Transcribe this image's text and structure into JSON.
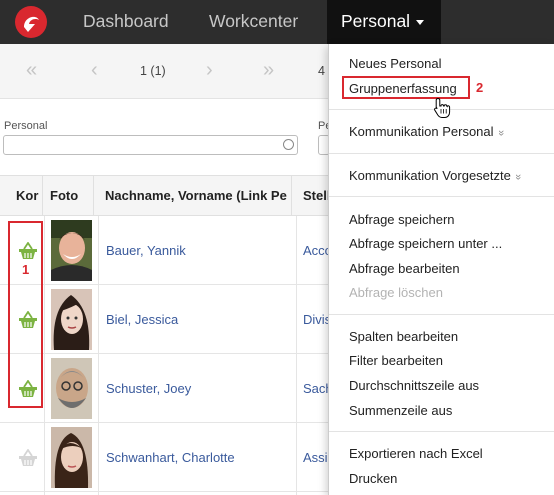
{
  "nav": {
    "items": [
      "Dashboard",
      "Workcenter",
      "Personal"
    ],
    "active": "Personal"
  },
  "pager": {
    "first": "«",
    "prev": "‹",
    "page": "1 (1)",
    "next": "›",
    "last": "»",
    "count_partial": "4"
  },
  "filters": {
    "personal_label": "Personal",
    "second_label_partial": "Pe"
  },
  "table": {
    "headers": [
      "Kor",
      "Foto",
      "Nachname, Vorname (Link Pe",
      "Stell"
    ],
    "rows": [
      {
        "name": "Bauer, Yannik",
        "stelle": "Acco",
        "basket": "active"
      },
      {
        "name": "Biel, Jessica",
        "stelle": "Divis",
        "basket": "active"
      },
      {
        "name": "Schuster, Joey",
        "stelle": "Sach",
        "basket": "active"
      },
      {
        "name": "Schwanhart, Charlotte",
        "stelle": "Assi",
        "basket": "inactive"
      }
    ]
  },
  "annotations": {
    "label1": "1",
    "label2": "2"
  },
  "menu": {
    "neues_personal": "Neues Personal",
    "gruppenerfassung": "Gruppenerfassung",
    "kommunikation_personal": "Kommunikation Personal",
    "kommunikation_vorgesetzte": "Kommunikation Vorgesetzte",
    "chevron": "»",
    "abfrage_speichern": "Abfrage speichern",
    "abfrage_speichern_unter": "Abfrage speichern unter ...",
    "abfrage_bearbeiten": "Abfrage bearbeiten",
    "abfrage_loeschen": "Abfrage löschen",
    "spalten_bearbeiten": "Spalten bearbeiten",
    "filter_bearbeiten": "Filter bearbeiten",
    "durchschnittszeile": "Durchschnittszeile aus",
    "summenzeile": "Summenzeile aus",
    "exportieren": "Exportieren nach Excel",
    "drucken": "Drucken"
  },
  "colors": {
    "accent_red": "#d9282f",
    "link_blue": "#3a5a9c",
    "basket_green": "#7cb342",
    "nav_bg": "#2d2d2d"
  }
}
